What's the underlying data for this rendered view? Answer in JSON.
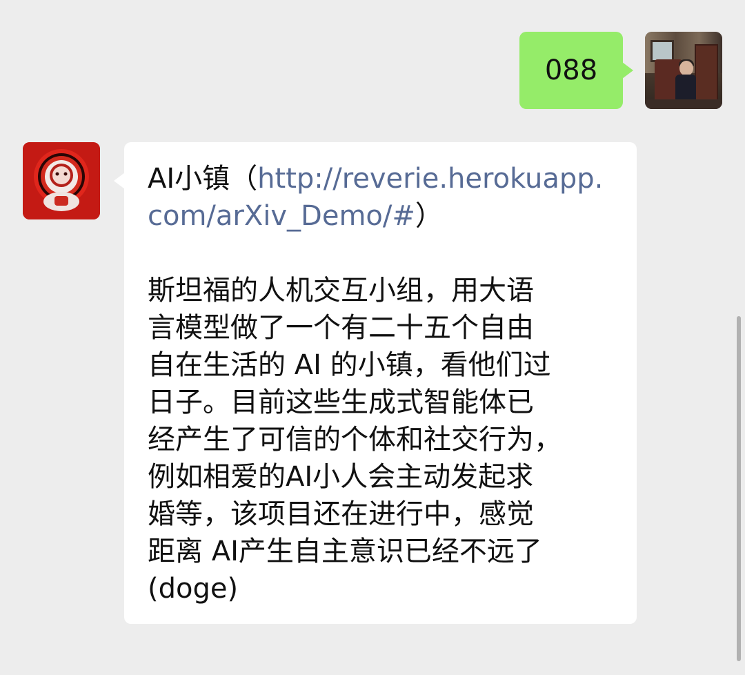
{
  "chat": {
    "outgoing": {
      "text": "088",
      "avatar_icon": "user-photo-avatar"
    },
    "incoming": {
      "avatar_icon": "astronaut-avatar",
      "title_prefix": "AI小镇（",
      "link": "http://reverie.herokuapp.com/arXiv_Demo/#",
      "title_suffix": "）",
      "lines": [
        "斯坦福的人机交互小组，用大语",
        "言模型做了一个有二十五个自由",
        "自在生活的 AI 的小镇，看他们过",
        "日子。目前这些生成式智能体已",
        "经产生了可信的个体和社交行为，",
        "例如相爱的AI小人会主动发起求",
        "婚等，该项目还在进行中，感觉",
        "距离 AI产生自主意识已经不远了",
        "(doge)"
      ]
    }
  },
  "colors": {
    "background": "#ededed",
    "outgoing_bubble": "#95ec69",
    "incoming_bubble": "#ffffff",
    "link": "#576b95",
    "avatar_red": "#c41a14"
  }
}
